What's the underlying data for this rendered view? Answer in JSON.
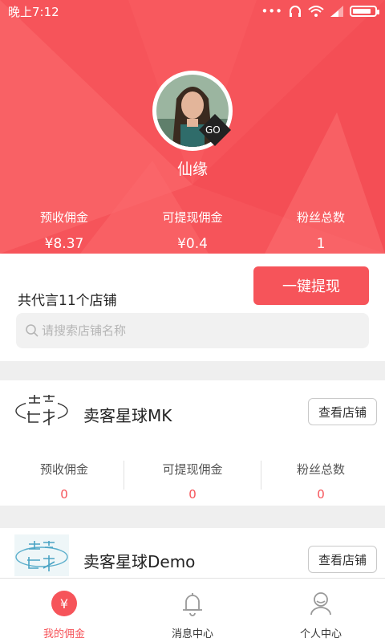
{
  "status_bar": {
    "time": "晚上7:12"
  },
  "profile": {
    "name": "仙缘",
    "badge": "GO"
  },
  "summary": [
    {
      "label": "预收佣金",
      "value": "¥8.37"
    },
    {
      "label": "可提现佣金",
      "value": "¥0.4"
    },
    {
      "label": "粉丝总数",
      "value": "1"
    }
  ],
  "shops_section": {
    "count_text": "共代言11个店铺",
    "withdraw_label": "一键提现",
    "search_placeholder": "请搜索店铺名称"
  },
  "shops": [
    {
      "name": "卖客星球MK",
      "view_label": "查看店铺",
      "stats": [
        {
          "label": "预收佣金",
          "value": "0"
        },
        {
          "label": "可提现佣金",
          "value": "0"
        },
        {
          "label": "粉丝总数",
          "value": "0"
        }
      ]
    },
    {
      "name": "卖客星球Demo",
      "view_label": "查看店铺"
    }
  ],
  "tabbar": [
    {
      "label": "我的佣金",
      "icon": "yen-icon",
      "active": true
    },
    {
      "label": "消息中心",
      "icon": "bell-icon",
      "active": false
    },
    {
      "label": "个人中心",
      "icon": "user-icon",
      "active": false
    }
  ],
  "colors": {
    "accent": "#f6545a",
    "header_bg": "#f6545a"
  }
}
